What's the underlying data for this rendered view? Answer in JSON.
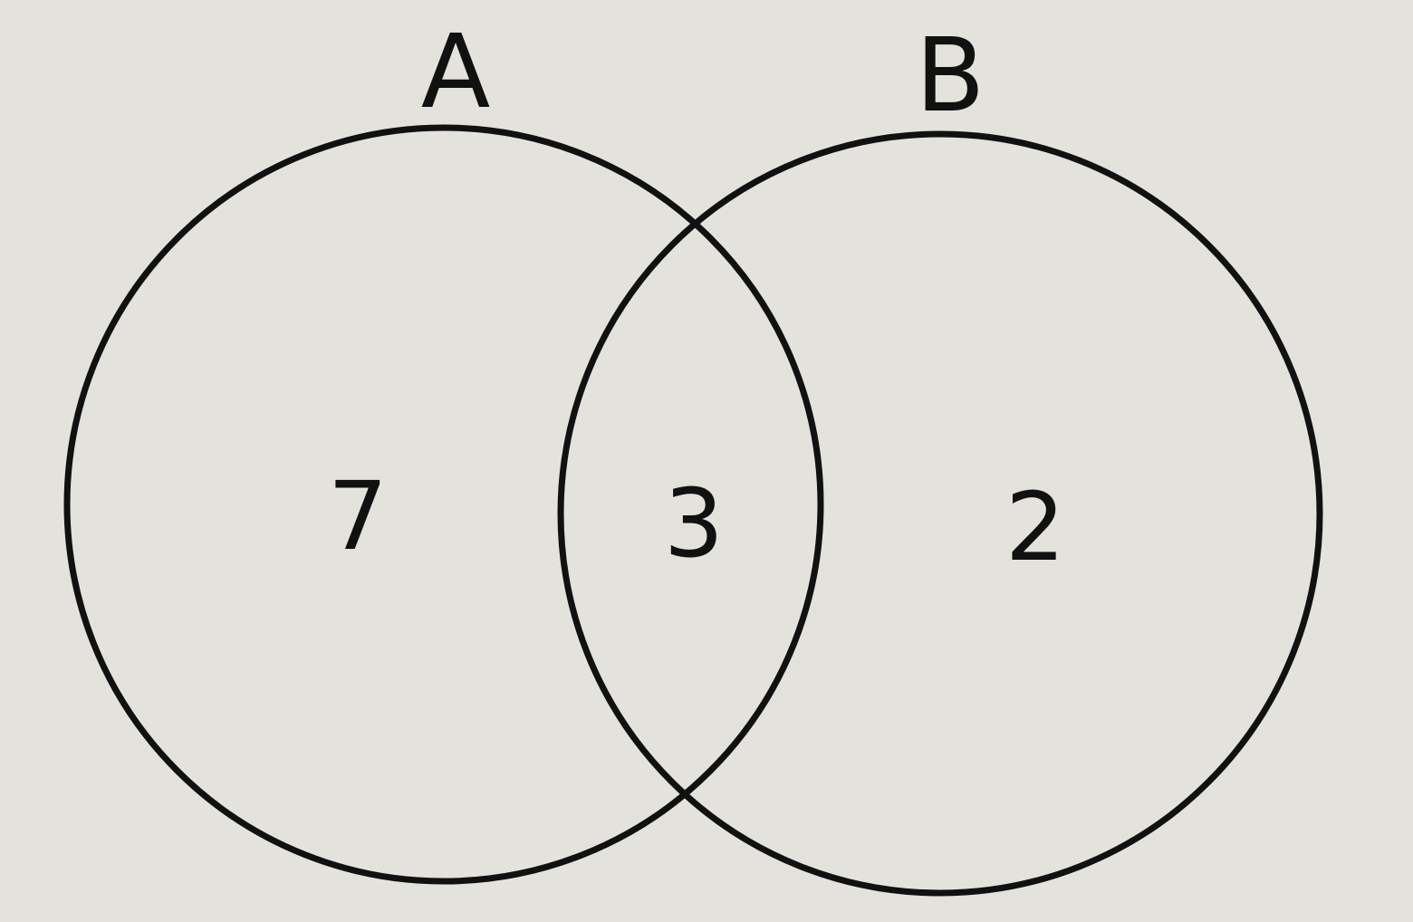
{
  "sets": {
    "a": {
      "label": "A"
    },
    "b": {
      "label": "B"
    }
  },
  "regions": {
    "only_a": "7",
    "both": "3",
    "only_b": "2"
  },
  "colors": {
    "background": "#e4e2dc",
    "ink": "#111111"
  }
}
